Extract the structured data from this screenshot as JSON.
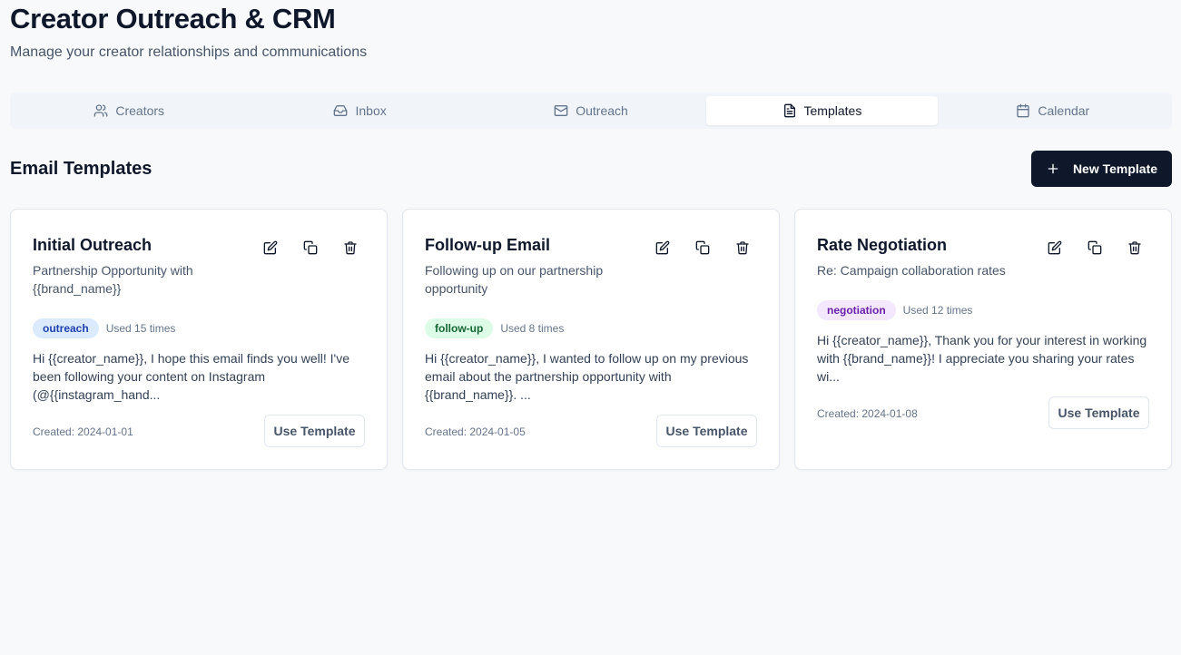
{
  "header": {
    "title": "Creator Outreach & CRM",
    "subtitle": "Manage your creator relationships and communications"
  },
  "tabs": [
    {
      "label": "Creators",
      "icon": "users-icon"
    },
    {
      "label": "Inbox",
      "icon": "inbox-icon"
    },
    {
      "label": "Outreach",
      "icon": "mail-icon"
    },
    {
      "label": "Templates",
      "icon": "file-text-icon",
      "active": true
    },
    {
      "label": "Calendar",
      "icon": "calendar-icon"
    }
  ],
  "section": {
    "title": "Email Templates",
    "new_button_label": "New Template"
  },
  "cards": [
    {
      "title": "Initial Outreach",
      "subject": "Partnership Opportunity with {{brand_name}}",
      "tag": "outreach",
      "tag_colors": {
        "bg": "#dbeafe",
        "fg": "#1e40af"
      },
      "usage": "Used 15 times",
      "body": "Hi {{creator_name}}, I hope this email finds you well! I've been following your content on Instagram (@{{instagram_hand...",
      "created": "Created: 2024-01-01",
      "use_label": "Use Template"
    },
    {
      "title": "Follow-up Email",
      "subject": "Following up on our partnership opportunity",
      "tag": "follow-up",
      "tag_colors": {
        "bg": "#dcfce7",
        "fg": "#166534"
      },
      "usage": "Used 8 times",
      "body": "Hi {{creator_name}}, I wanted to follow up on my previous email about the partnership opportunity with {{brand_name}}. ...",
      "created": "Created: 2024-01-05",
      "use_label": "Use Template"
    },
    {
      "title": "Rate Negotiation",
      "subject": "Re: Campaign collaboration rates",
      "tag": "negotiation",
      "tag_colors": {
        "bg": "#f3e8ff",
        "fg": "#6b21a8"
      },
      "usage": "Used 12 times",
      "body": "Hi {{creator_name}}, Thank you for your interest in working with {{brand_name}}! I appreciate you sharing your rates wi...",
      "created": "Created: 2024-01-08",
      "use_label": "Use Template"
    }
  ],
  "colors": {
    "primary": "#0f172a",
    "background": "#f8f9fb",
    "muted": "#64748b"
  }
}
